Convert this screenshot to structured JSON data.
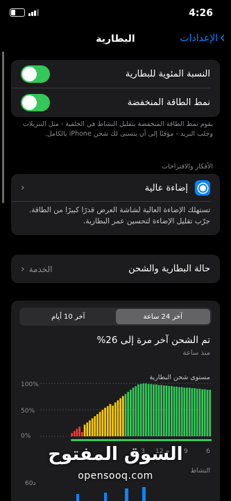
{
  "status_bar": {
    "time": "4:26",
    "battery_level": "9"
  },
  "nav": {
    "back_label": "الإعدادات",
    "title": "البطارية"
  },
  "toggles": [
    {
      "label": "النسبة المئوية للبطارية",
      "on": true
    },
    {
      "label": "نمط الطاقة المنخفضة",
      "on": true
    }
  ],
  "low_power_note": "يقوم نمط الطاقة المنخفضة بتقليل النشاط في الخلفية - مثل التنزيلات وجلب البريد - مؤقتًا إلى أن يتسنى لك شحن iPhone بالكامل.",
  "insights_header": "الأفكار والاقتراحات",
  "suggestion": {
    "title": "إضاءة عالية",
    "icon": "sun-icon",
    "body": "تستهلك الإضاءة العالية لشاشة العرض قدرًا كبيرًا من الطاقة. جرّب تقليل الإضاءة لتحسين عمر البطارية."
  },
  "health": {
    "label": "حالة البطارية والشحن",
    "value": "الخدمة"
  },
  "segments": {
    "selected": "آخر 24 ساعة",
    "other": "آخر 10 أيام"
  },
  "last_charge": {
    "title": "تم الشحن آخر مرة إلى 26%",
    "subtitle": "منذ ساعة"
  },
  "chart_labels": {
    "battery_level_title": "مستوى شحن البطارية",
    "y_ticks": [
      "100%",
      "50%",
      "0%"
    ],
    "x_ticks": [
      "6",
      "9",
      "12 م",
      "3"
    ],
    "activity_title": "النشاط",
    "activity_ytick": "60د"
  },
  "watermark": {
    "arabic": "السوق المفتوح",
    "latin": "opensooq.com"
  },
  "colors": {
    "accent": "#0a84ff",
    "toggle_on": "#34c759",
    "low": "#ff3b30",
    "mid": "#ffcc00",
    "high": "#34c759"
  },
  "chart_data": {
    "type": "bar",
    "title": "مستوى شحن البطارية",
    "ylim": [
      0,
      100
    ],
    "x_ticks": [
      "3",
      "12 م",
      "9",
      "6"
    ],
    "bars_ltr": [
      0,
      0,
      0,
      0,
      0,
      0,
      0,
      0,
      0,
      0,
      0,
      0,
      6,
      10,
      14,
      18,
      8,
      22,
      26,
      30,
      34,
      38,
      42,
      46,
      50,
      54,
      57,
      61,
      58,
      64,
      68,
      72,
      76,
      80,
      84,
      88,
      92,
      95,
      98,
      99,
      100,
      100,
      99,
      99,
      98,
      98,
      97,
      97,
      96,
      96,
      95,
      95,
      94,
      94,
      93,
      93,
      92,
      92,
      92,
      91,
      91,
      90,
      90,
      89,
      89,
      88,
      88
    ]
  }
}
